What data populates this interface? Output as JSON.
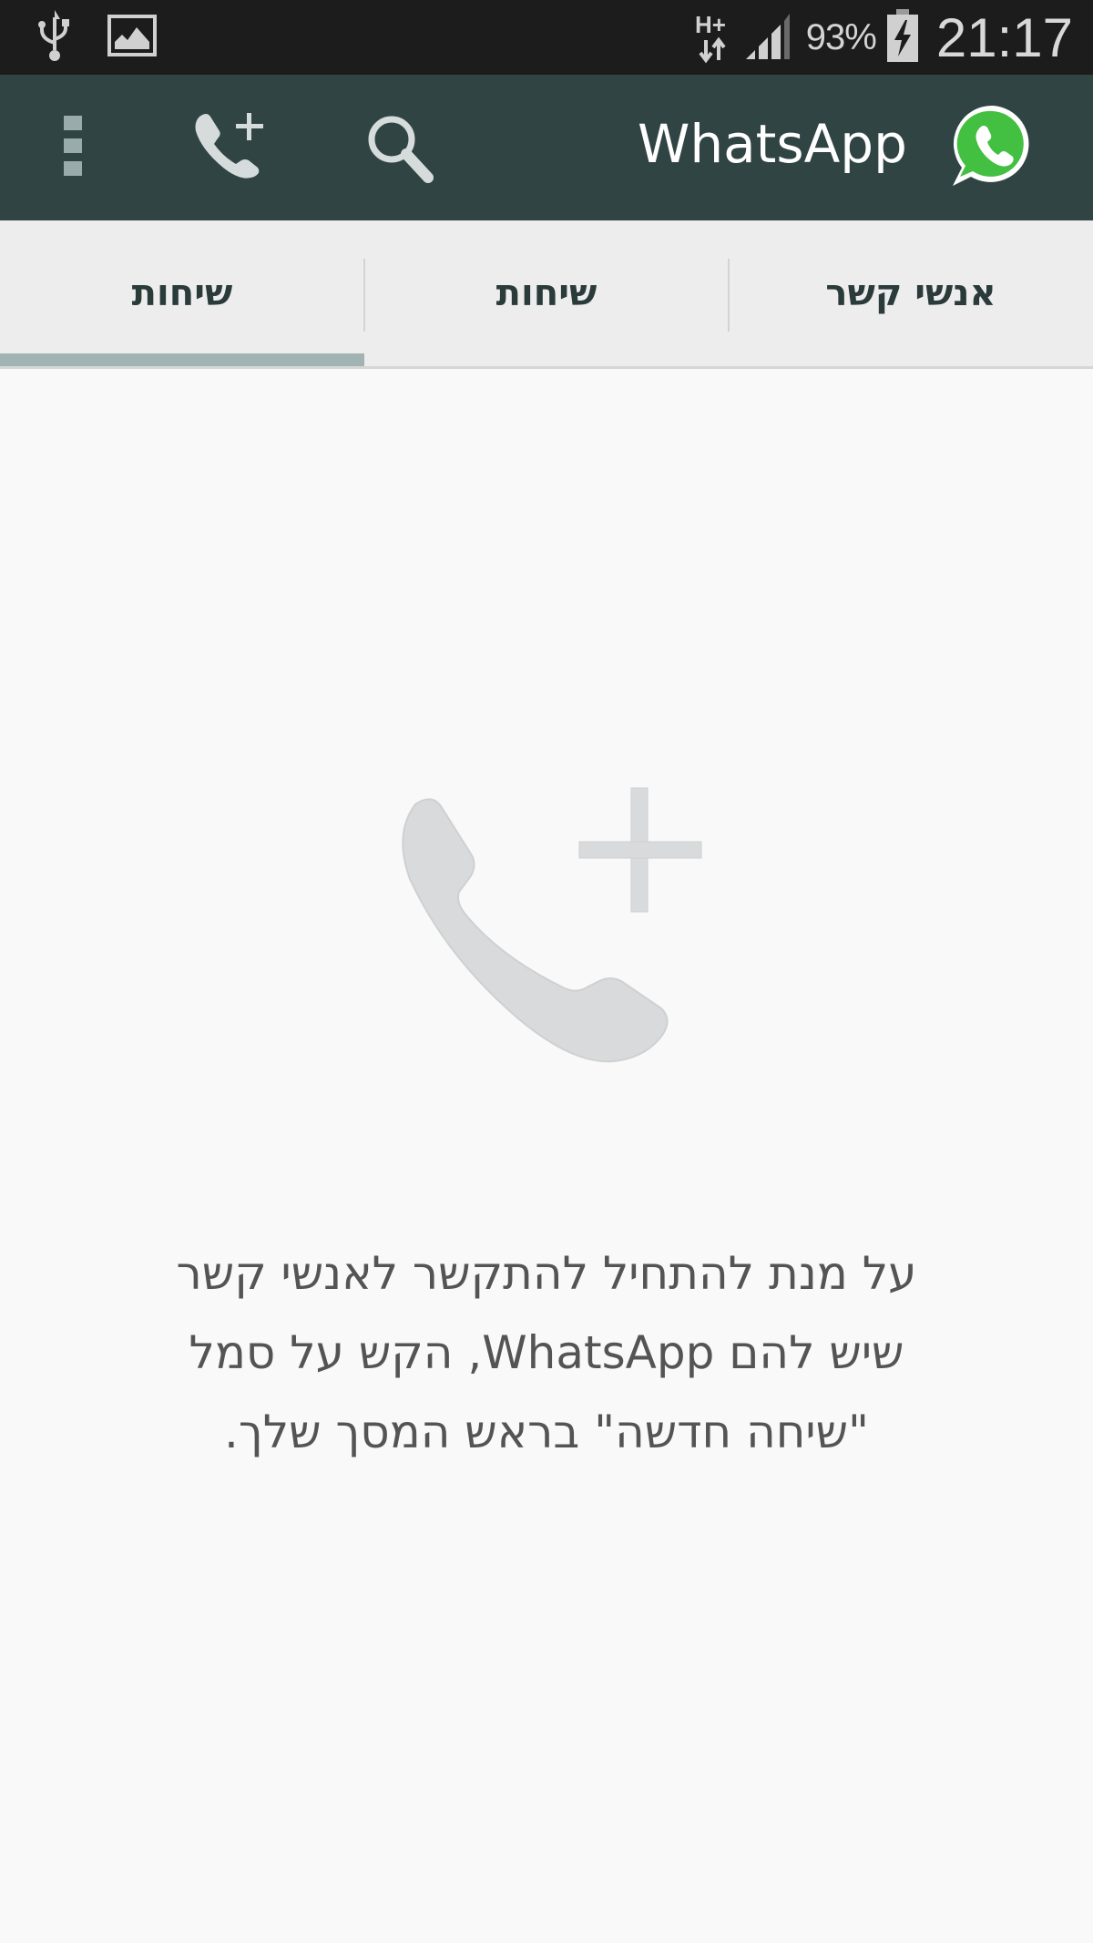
{
  "status_bar": {
    "left_icons": [
      "usb-icon",
      "image-notification-icon"
    ],
    "network_type": "H+",
    "battery_percent": "93%",
    "battery_state": "charging",
    "time": "21:17"
  },
  "app_bar": {
    "title": "WhatsApp",
    "logo": "whatsapp-logo-icon",
    "actions": [
      "search-icon",
      "new-call-icon",
      "overflow-menu-icon"
    ],
    "brand_color": "#2f4443",
    "logo_color": "#43c042"
  },
  "tabs": [
    {
      "label": "אנשי קשר",
      "selected": false
    },
    {
      "label": "שיחות",
      "selected": false
    },
    {
      "label": "שיחות",
      "selected": true
    }
  ],
  "empty_state": {
    "icon": "phone-plus-icon",
    "lines": [
      "על מנת להתחיל להתקשר לאנשי קשר",
      "שיש להם WhatsApp, הקש על סמל",
      "\"שיחה חדשה\" בראש המסך שלך."
    ]
  }
}
